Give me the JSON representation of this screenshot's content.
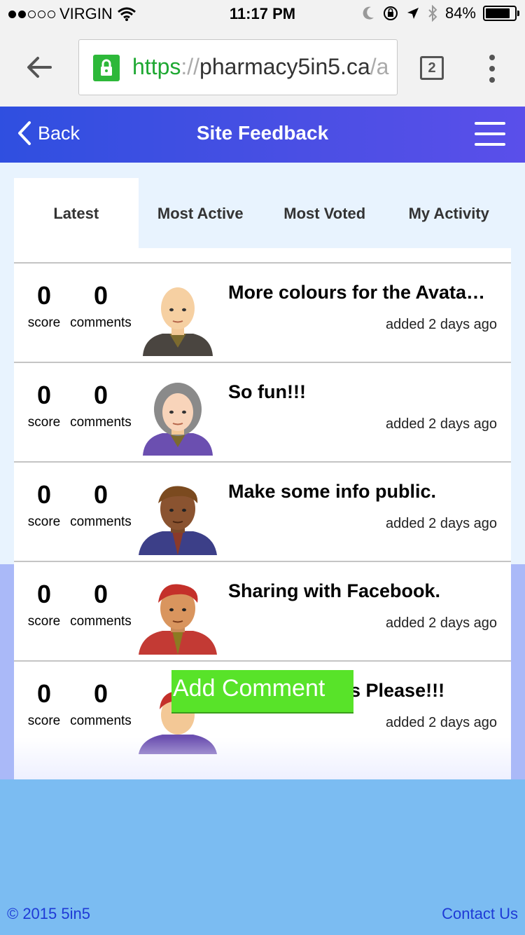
{
  "status_bar": {
    "carrier": "VIRGIN",
    "time": "11:17 PM",
    "battery": "84%",
    "battery_level": 0.84
  },
  "browser": {
    "url_scheme": "https",
    "url_sep": "://",
    "url_host": "pharmacy5in5.ca",
    "url_tail": "/a",
    "tab_count": "2"
  },
  "header": {
    "back_label": "Back",
    "title": "Site Feedback"
  },
  "tabs": [
    {
      "label": "Latest",
      "active": true
    },
    {
      "label": "Most Active",
      "active": false
    },
    {
      "label": "Most Voted",
      "active": false
    },
    {
      "label": "My Activity",
      "active": false
    }
  ],
  "feedback_items": [
    {
      "score": "0",
      "score_label": "score",
      "comments": "0",
      "comments_label": "comments",
      "title": "More colours for the Avata…",
      "added": "added 2 days ago",
      "avatar": "bald-man-avatar-icon"
    },
    {
      "score": "0",
      "score_label": "score",
      "comments": "0",
      "comments_label": "comments",
      "title": "So fun!!!",
      "added": "added 2 days ago",
      "avatar": "grey-haired-woman-avatar-icon"
    },
    {
      "score": "0",
      "score_label": "score",
      "comments": "0",
      "comments_label": "comments",
      "title": "Make some info public.",
      "added": "added 2 days ago",
      "avatar": "brown-haired-man-avatar-icon"
    },
    {
      "score": "0",
      "score_label": "score",
      "comments": "0",
      "comments_label": "comments",
      "title": "Sharing with Facebook.",
      "added": "added 2 days ago",
      "avatar": "red-haired-man-avatar-icon"
    },
    {
      "score": "0",
      "score_label": "score",
      "comments": "0",
      "comments_label": "comments",
      "title": "s Please!!!",
      "added": "added 2 days ago",
      "avatar": "red-haired-person-avatar-icon"
    }
  ],
  "add_comment_label": "Add Comment",
  "footer": {
    "copyright": "© 2015 5in5",
    "contact": "Contact Us"
  },
  "colors": {
    "header_start": "#2f4fe0",
    "header_end": "#5a4fea",
    "add_comment": "#58e329",
    "footer_link": "#1e3ad6"
  }
}
